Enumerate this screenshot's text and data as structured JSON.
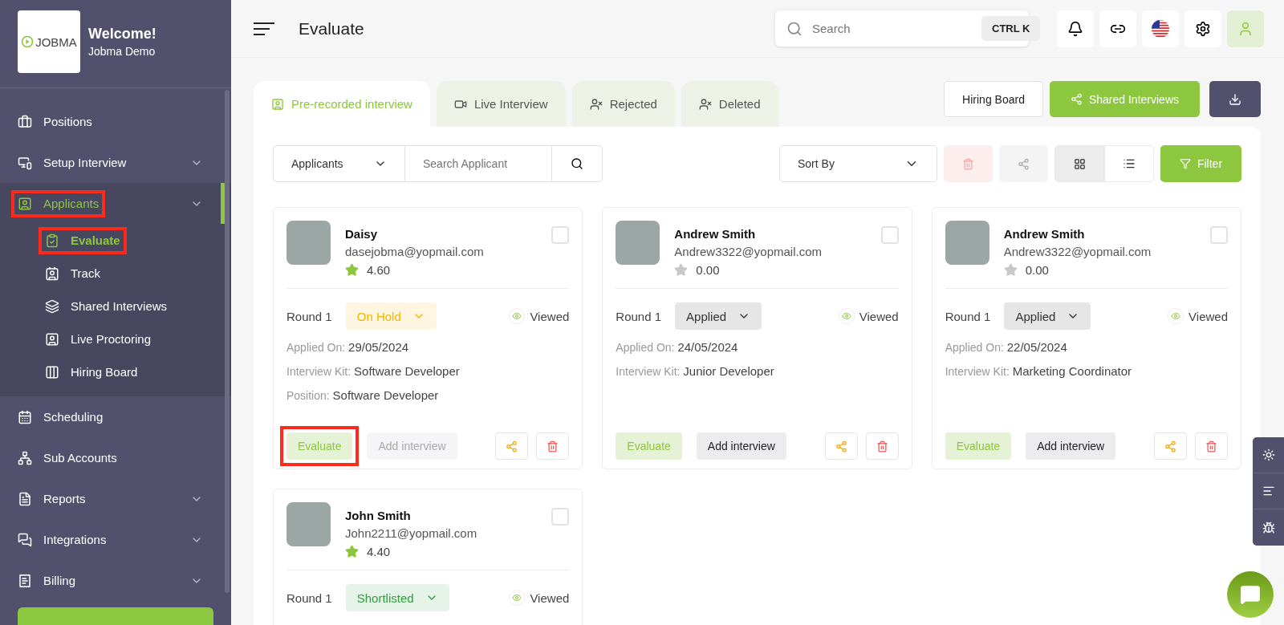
{
  "brand": {
    "logo": "JOBMA",
    "welcome": "Welcome!",
    "user": "Jobma Demo"
  },
  "sidebar": {
    "items": [
      {
        "label": "Positions",
        "expandable": false,
        "selected": false,
        "highlighted": false
      },
      {
        "label": "Setup Interview",
        "expandable": true,
        "selected": false,
        "highlighted": false
      },
      {
        "label": "Applicants",
        "expandable": true,
        "selected": true,
        "highlighted": true,
        "children": [
          {
            "label": "Evaluate",
            "selected": true,
            "highlighted": true
          },
          {
            "label": "Track",
            "selected": false,
            "highlighted": false
          },
          {
            "label": "Shared Interviews",
            "selected": false,
            "highlighted": false
          },
          {
            "label": "Live Proctoring",
            "selected": false,
            "highlighted": false
          },
          {
            "label": "Hiring Board",
            "selected": false,
            "highlighted": false
          }
        ]
      },
      {
        "label": "Scheduling",
        "expandable": false,
        "selected": false,
        "highlighted": false
      },
      {
        "label": "Sub Accounts",
        "expandable": false,
        "selected": false,
        "highlighted": false
      },
      {
        "label": "Reports",
        "expandable": true,
        "selected": false,
        "highlighted": false
      },
      {
        "label": "Integrations",
        "expandable": true,
        "selected": false,
        "highlighted": false
      },
      {
        "label": "Billing",
        "expandable": true,
        "selected": false,
        "highlighted": false
      }
    ]
  },
  "header": {
    "title": "Evaluate",
    "search": {
      "placeholder": "Search",
      "shortcut": "CTRL K"
    }
  },
  "tabs": [
    {
      "label": "Pre-recorded interview",
      "selected": true
    },
    {
      "label": "Live Interview",
      "selected": false
    },
    {
      "label": "Rejected",
      "selected": false
    },
    {
      "label": "Deleted",
      "selected": false
    }
  ],
  "actions": {
    "hiring_board": "Hiring Board",
    "shared_interviews": "Shared Interviews"
  },
  "toolbar": {
    "filter_select": "Applicants",
    "search_placeholder": "Search Applicant",
    "sort": "Sort By",
    "filter": "Filter",
    "views": [
      {
        "kind": "grid",
        "selected": true
      },
      {
        "kind": "list",
        "selected": false
      }
    ]
  },
  "applicants": [
    {
      "name": "Daisy",
      "email": "dasejobma@yopmail.com",
      "rating": "4.60",
      "rated": true,
      "round": "Round 1",
      "status": "On Hold",
      "color": "#f5b400",
      "viewed": "Viewed",
      "details": [
        {
          "label": "Applied On:",
          "value": "29/05/2024"
        },
        {
          "label": "Interview Kit:",
          "value": "Software Developer"
        },
        {
          "label": "Position:",
          "value": "Software Developer"
        }
      ],
      "evaluate": "Evaluate",
      "evaluate_highlighted": true,
      "add_interview": "Add interview",
      "add_disabled": true,
      "checked": false
    },
    {
      "name": "Andrew Smith",
      "email": "Andrew3322@yopmail.com",
      "rating": "0.00",
      "rated": false,
      "round": "Round 1",
      "status": "Applied",
      "color": "#333333",
      "viewed": "Viewed",
      "details": [
        {
          "label": "Applied On:",
          "value": "24/05/2024"
        },
        {
          "label": "Interview Kit:",
          "value": "Junior Developer"
        }
      ],
      "evaluate": "Evaluate",
      "evaluate_highlighted": false,
      "add_interview": "Add interview",
      "add_disabled": false,
      "checked": false
    },
    {
      "name": "Andrew Smith",
      "email": "Andrew3322@yopmail.com",
      "rating": "0.00",
      "rated": false,
      "round": "Round 1",
      "status": "Applied",
      "color": "#333333",
      "viewed": "Viewed",
      "details": [
        {
          "label": "Applied On:",
          "value": "22/05/2024"
        },
        {
          "label": "Interview Kit:",
          "value": "Marketing Coordinator"
        }
      ],
      "evaluate": "Evaluate",
      "evaluate_highlighted": false,
      "add_interview": "Add interview",
      "add_disabled": false,
      "checked": false
    },
    {
      "name": "John Smith",
      "email": "John2211@yopmail.com",
      "rating": "4.40",
      "rated": true,
      "round": "Round 1",
      "status": "Shortlisted",
      "color": "#2e9e3e",
      "viewed": "Viewed",
      "checked": false
    }
  ]
}
